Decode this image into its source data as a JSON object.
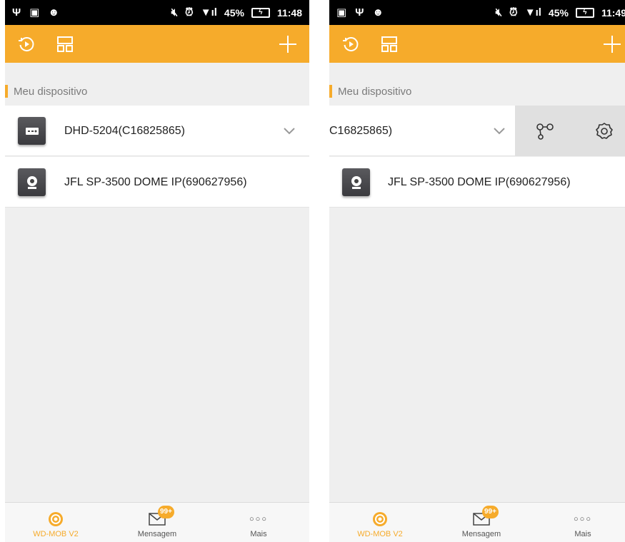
{
  "colors": {
    "accent": "#f6ab2b",
    "toolbar": "#f6ab2b",
    "statusbar": "#000000",
    "background": "#efefef"
  },
  "screens": [
    {
      "status": {
        "time": "11:48",
        "battery": "45%"
      },
      "section_title": "Meu dispositivo",
      "devices": [
        {
          "label": "DHD-5204(C16825865)",
          "icon": "dvr-recorder-icon",
          "expandable": true
        },
        {
          "label": "JFL SP-3500 DOME IP(690627956)",
          "icon": "ip-camera-icon",
          "expandable": false
        }
      ],
      "tabs": [
        {
          "label": "WD-MOB V2",
          "icon": "home-target-icon",
          "active": true
        },
        {
          "label": "Mensagem",
          "icon": "envelope-icon",
          "badge": "99+"
        },
        {
          "label": "Mais",
          "icon": "more-dots-icon"
        }
      ]
    },
    {
      "status": {
        "time": "11:49",
        "battery": "45%"
      },
      "section_title": "Meu dispositivo",
      "devices": [
        {
          "label": "C16825865)",
          "icon": "dvr-recorder-icon",
          "expandable": true,
          "swiped": true,
          "actions": [
            "share-icon",
            "settings-gear-icon"
          ]
        },
        {
          "label": "JFL SP-3500 DOME IP(690627956)",
          "icon": "ip-camera-icon",
          "expandable": false
        }
      ],
      "tabs": [
        {
          "label": "WD-MOB V2",
          "icon": "home-target-icon",
          "active": true
        },
        {
          "label": "Mensagem",
          "icon": "envelope-icon",
          "badge": "99+"
        },
        {
          "label": "Mais",
          "icon": "more-dots-icon"
        }
      ]
    }
  ]
}
